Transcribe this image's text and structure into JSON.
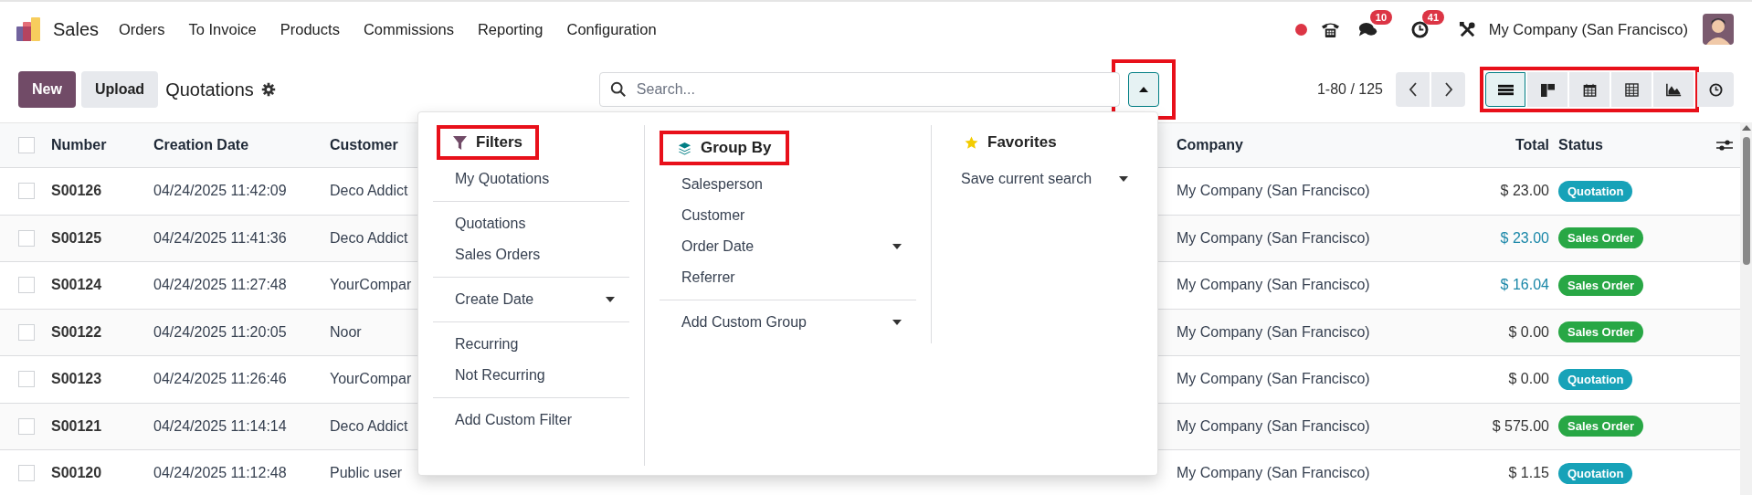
{
  "navbar": {
    "app_name": "Sales",
    "menu": [
      "Orders",
      "To Invoice",
      "Products",
      "Commissions",
      "Reporting",
      "Configuration"
    ],
    "chat_count": "10",
    "activity_count": "41",
    "company": "My Company (San Francisco)"
  },
  "control_panel": {
    "buttons": [
      {
        "label": "New",
        "kind": "primary"
      },
      {
        "label": "Upload",
        "kind": "secondary"
      }
    ],
    "title": "Quotations",
    "search": {
      "placeholder": "Search..."
    },
    "toggle": {
      "expanded": true,
      "highlighted": true
    },
    "pager": "1-80 / 125",
    "views": {
      "highlighted": true,
      "items": [
        {
          "kind": "list",
          "selected": true
        },
        {
          "kind": "kanban",
          "selected": false
        },
        {
          "kind": "calendar",
          "selected": false
        },
        {
          "kind": "pivot",
          "selected": false
        },
        {
          "kind": "graph",
          "selected": false
        }
      ]
    }
  },
  "table": {
    "select_all_checked": false,
    "columns": [
      "Number",
      "Creation Date",
      "Customer",
      "Company",
      "Total",
      "Status"
    ],
    "rows": [
      {
        "checked": false,
        "number": "S00126",
        "created": "04/24/2025 11:42:09",
        "customer": "Deco Addict",
        "company": "My Company (San Francisco)",
        "total": "$ 23.00",
        "emphasis": false,
        "status": {
          "label": "Quotation",
          "color": "#17a2b8"
        }
      },
      {
        "checked": false,
        "number": "S00125",
        "created": "04/24/2025 11:41:36",
        "customer": "Deco Addict",
        "company": "My Company (San Francisco)",
        "total": "$ 23.00",
        "emphasis": true,
        "status": {
          "label": "Sales Order",
          "color": "#28a745"
        }
      },
      {
        "checked": false,
        "number": "S00124",
        "created": "04/24/2025 11:27:48",
        "customer": "YourCompar",
        "company": "My Company (San Francisco)",
        "total": "$ 16.04",
        "emphasis": true,
        "status": {
          "label": "Sales Order",
          "color": "#28a745"
        }
      },
      {
        "checked": false,
        "number": "S00122",
        "created": "04/24/2025 11:20:05",
        "customer": "Noor",
        "company": "My Company (San Francisco)",
        "total": "$ 0.00",
        "emphasis": false,
        "status": {
          "label": "Sales Order",
          "color": "#28a745"
        }
      },
      {
        "checked": false,
        "number": "S00123",
        "created": "04/24/2025 11:26:46",
        "customer": "YourCompar",
        "company": "My Company (San Francisco)",
        "total": "$ 0.00",
        "emphasis": false,
        "status": {
          "label": "Quotation",
          "color": "#17a2b8"
        }
      },
      {
        "checked": false,
        "number": "S00121",
        "created": "04/24/2025 11:14:14",
        "customer": "Deco Addict",
        "company": "My Company (San Francisco)",
        "total": "$ 575.00",
        "emphasis": false,
        "status": {
          "label": "Sales Order",
          "color": "#28a745"
        }
      },
      {
        "checked": false,
        "number": "S00120",
        "created": "04/24/2025 11:12:48",
        "customer": "Public user",
        "company": "My Company (San Francisco)",
        "total": "$ 1.15",
        "emphasis": false,
        "status": {
          "label": "Quotation",
          "color": "#17a2b8"
        }
      }
    ]
  },
  "search_panel": {
    "columns": [
      {
        "kind": "filters",
        "title": "Filters",
        "highlighted": true,
        "sections": [
          [
            {
              "label": "My Quotations",
              "kind": "option"
            }
          ],
          [
            {
              "label": "Quotations",
              "kind": "option"
            },
            {
              "label": "Sales Orders",
              "kind": "option"
            }
          ],
          [
            {
              "label": "Create Date",
              "kind": "submenu"
            }
          ],
          [
            {
              "label": "Recurring",
              "kind": "option"
            },
            {
              "label": "Not Recurring",
              "kind": "option"
            }
          ],
          [
            {
              "label": "Add Custom Filter",
              "kind": "option"
            }
          ]
        ]
      },
      {
        "kind": "group_by",
        "title": "Group By",
        "highlighted": true,
        "sections": [
          [
            {
              "label": "Salesperson",
              "kind": "option"
            },
            {
              "label": "Customer",
              "kind": "option"
            },
            {
              "label": "Order Date",
              "kind": "submenu"
            },
            {
              "label": "Referrer",
              "kind": "option"
            }
          ],
          [
            {
              "label": "Add Custom Group",
              "kind": "submenu"
            }
          ]
        ]
      },
      {
        "kind": "favorites",
        "title": "Favorites",
        "sections": [
          [
            {
              "label": "Save current search",
              "kind": "submenu"
            }
          ]
        ]
      }
    ]
  }
}
